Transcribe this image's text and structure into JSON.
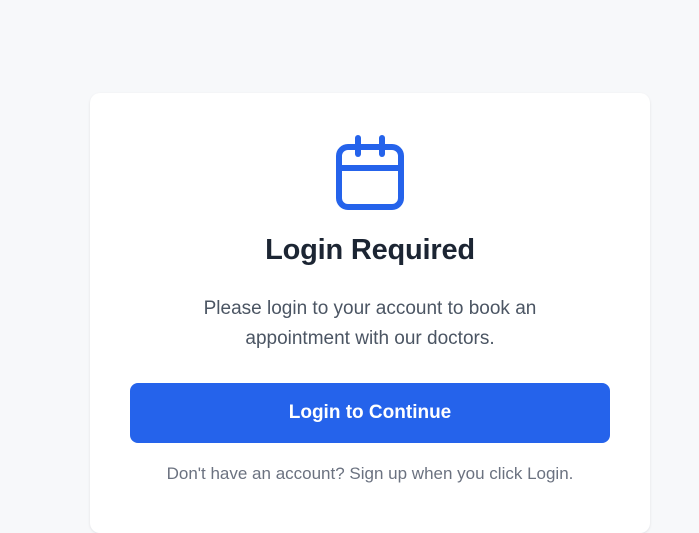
{
  "card": {
    "icon": "calendar-icon",
    "title": "Login Required",
    "message": "Please login to your account to book an appointment with our doctors.",
    "button_label": "Login to Continue",
    "footnote": "Don't have an account? Sign up when you click Login."
  },
  "colors": {
    "accent": "#2563eb",
    "title": "#1c2533",
    "body_text": "#4b5563",
    "muted_text": "#6b7280",
    "page_background": "#f7f8fa",
    "card_background": "#ffffff"
  }
}
